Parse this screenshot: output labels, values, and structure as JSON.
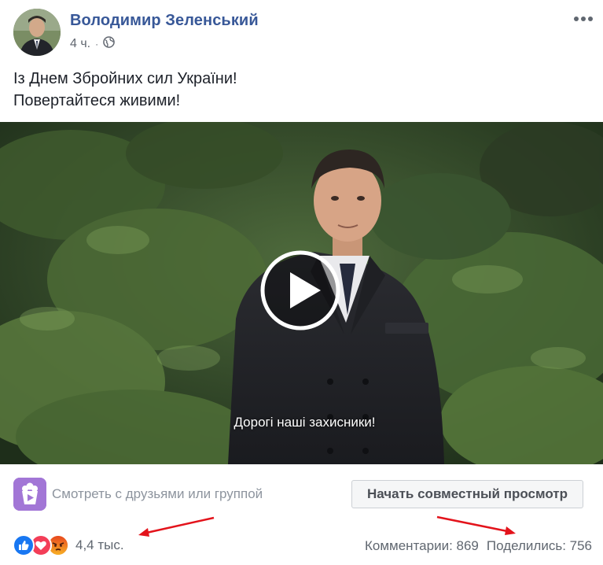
{
  "post": {
    "author": "Володимир Зеленський",
    "time": "4 ч.",
    "privacy_icon": "globe-icon",
    "more_icon": "more-horizontal-icon",
    "text_lines": [
      "Із Днем Збройних сил України!",
      "Повертайтеся живими!"
    ]
  },
  "video": {
    "caption": "Дорогі наші захисники!",
    "play_icon": "play-icon"
  },
  "watch_party": {
    "icon": "watch-party-icon",
    "text": "Смотреть с друзьями или группой",
    "button_label": "Начать совместный просмотр"
  },
  "engagement": {
    "reaction_icons": [
      "like-icon",
      "love-icon",
      "angry-icon"
    ],
    "reaction_count": "4,4 тыс.",
    "comments": "Комментарии: 869",
    "shares": "Поделились: 756"
  },
  "colors": {
    "author_link": "#385898",
    "like_blue": "#1877f2",
    "love_red": "#f33e58",
    "angry_orange": "#e9710f",
    "watch_party_purple": "#a276d6",
    "annotation_arrow": "#e3131b"
  }
}
